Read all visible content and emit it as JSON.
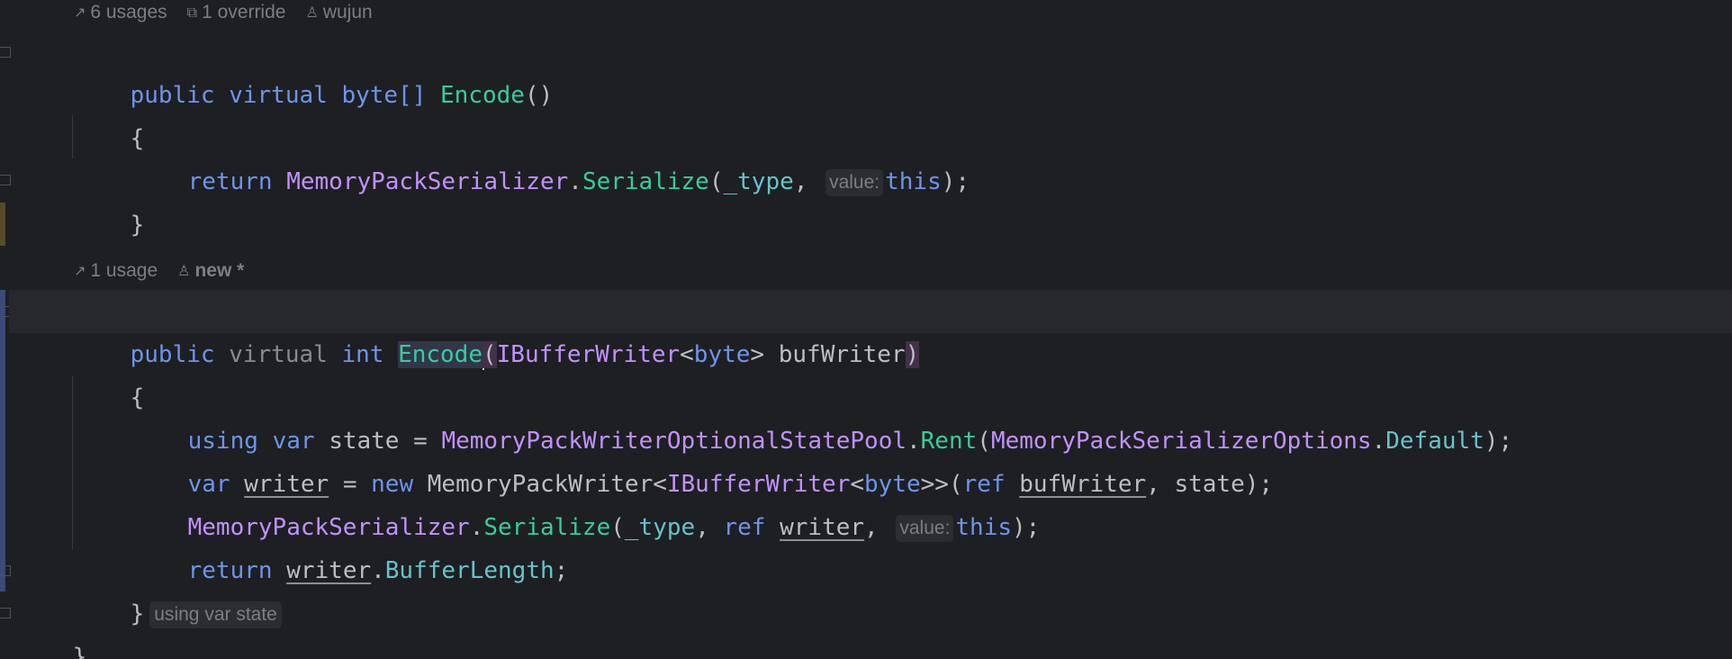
{
  "hints": {
    "block1": {
      "usages": "6 usages",
      "overrides": "1 override",
      "author": "wujun",
      "usages_icon": "external-link-icon",
      "overrides_icon": "override-icon",
      "author_icon": "person-icon"
    },
    "block2": {
      "usages": "1 usage",
      "author": "new *",
      "usages_icon": "external-link-icon",
      "author_icon": "person-icon"
    }
  },
  "code": {
    "l1": {
      "public": "public",
      "virtual": "virtual",
      "type": "byte[]",
      "name": "Encode",
      "parens": "()"
    },
    "l2": {
      "brace": "{"
    },
    "l3": {
      "ret": "return",
      "cls": "MemoryPackSerializer",
      "dot": ".",
      "m": "Serialize",
      "open": "(",
      "arg1": "_type",
      "comma": ",",
      "inlay": "value:",
      "arg2": "this",
      "close": ");"
    },
    "l4": {
      "brace": "}"
    },
    "l5": {
      "public": "public",
      "virtual": "virtual",
      "type": "int",
      "name": "Encode",
      "open": "(",
      "ptype": "IBufferWriter",
      "lt": "<",
      "gtype": "byte",
      "gt": ">",
      "pname": "bufWriter",
      "close": ")"
    },
    "l6": {
      "brace": "{"
    },
    "l7": {
      "using": "using",
      "var": "var",
      "name": "state",
      "eq": "=",
      "cls": "MemoryPackWriterOptionalStatePool",
      "dot": ".",
      "m": "Rent",
      "open": "(",
      "arg": "MemoryPackSerializerOptions",
      "dot2": ".",
      "f": "Default",
      "close": ");"
    },
    "l8": {
      "var": "var",
      "name": "writer",
      "eq": "=",
      "new": "new",
      "cls": "MemoryPackWriter",
      "lt": "<",
      "gcls": "IBufferWriter",
      "lt2": "<",
      "gtype": "byte",
      "gts": ">>",
      "open": "(",
      "ref": "ref",
      "arg1": "bufWriter",
      "comma": ",",
      "arg2": "state",
      "close": ");"
    },
    "l9": {
      "cls": "MemoryPackSerializer",
      "dot": ".",
      "m": "Serialize",
      "open": "(",
      "arg1": "_type",
      "comma": ",",
      "ref": "ref",
      "arg2": "writer",
      "comma2": ",",
      "inlay": "value:",
      "arg3": "this",
      "close": ");"
    },
    "l10": {
      "ret": "return",
      "name": "writer",
      "dot": ".",
      "f": "BufferLength",
      "semi": ";"
    },
    "l11": {
      "brace": "}",
      "hint": "using var state"
    },
    "l12": {
      "brace": "}"
    }
  },
  "colors": {
    "background": "#1e1f22",
    "keyword": "#6c95eb",
    "class": "#c191ff",
    "method": "#39cc9b",
    "field": "#66c3cc",
    "text": "#bcbec4",
    "hint": "#7a7e85"
  }
}
